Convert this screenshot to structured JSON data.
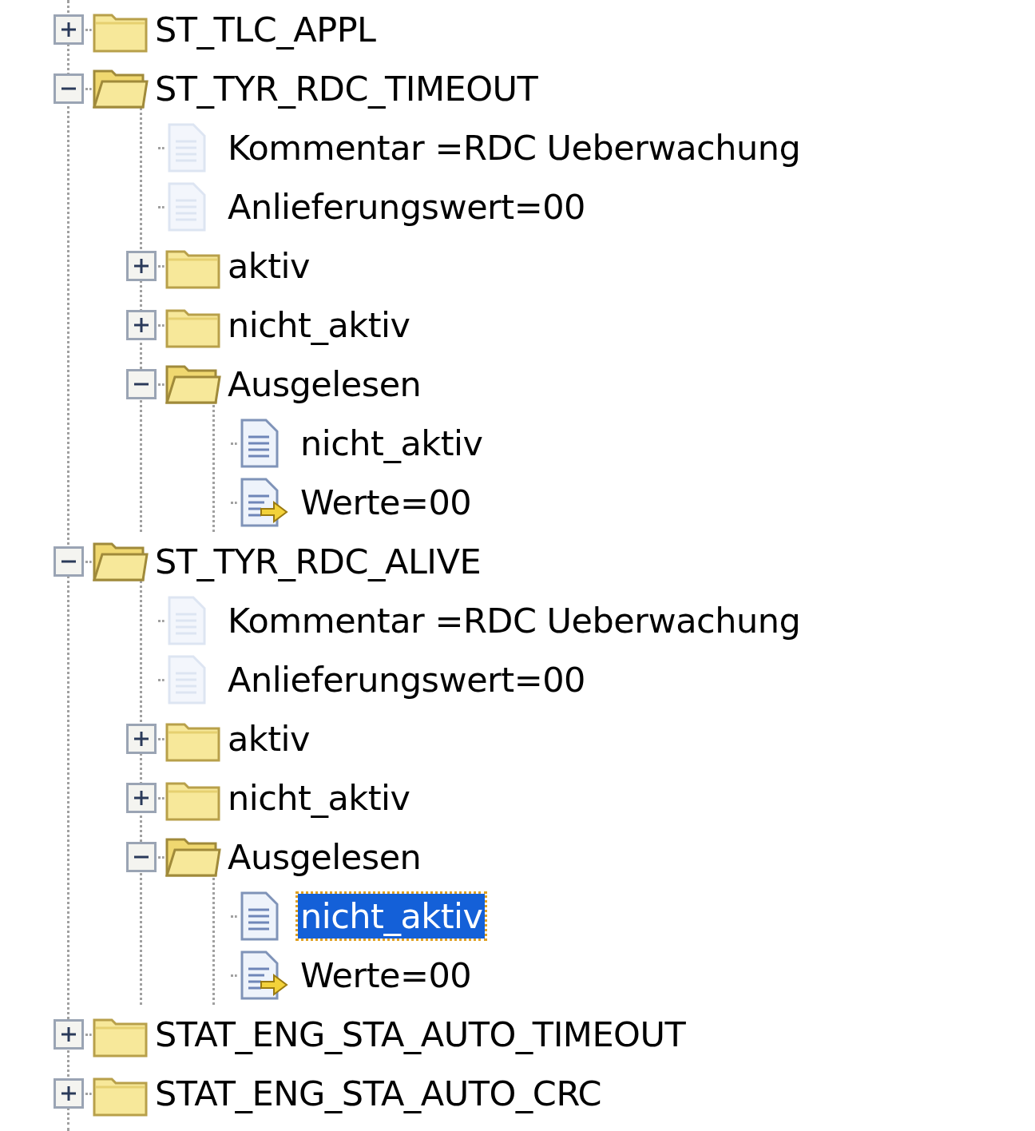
{
  "tree": [
    {
      "label": "ST_TLC_APPL",
      "kind": "folder",
      "expanded": false,
      "selected": false
    },
    {
      "label": "ST_TYR_RDC_TIMEOUT",
      "kind": "folder",
      "expanded": true,
      "selected": false,
      "children": [
        {
          "label": "Kommentar =RDC Ueberwachung",
          "kind": "faded-doc",
          "selected": false
        },
        {
          "label": "Anlieferungswert=00",
          "kind": "faded-doc",
          "selected": false
        },
        {
          "label": "aktiv",
          "kind": "folder",
          "expanded": false,
          "selected": false
        },
        {
          "label": "nicht_aktiv",
          "kind": "folder",
          "expanded": false,
          "selected": false
        },
        {
          "label": "Ausgelesen",
          "kind": "folder",
          "expanded": true,
          "selected": false,
          "children": [
            {
              "label": "nicht_aktiv",
              "kind": "doc",
              "selected": false
            },
            {
              "label": "Werte=00",
              "kind": "arrow-doc",
              "selected": false
            }
          ]
        }
      ]
    },
    {
      "label": "ST_TYR_RDC_ALIVE",
      "kind": "folder",
      "expanded": true,
      "selected": false,
      "children": [
        {
          "label": "Kommentar =RDC Ueberwachung",
          "kind": "faded-doc",
          "selected": false
        },
        {
          "label": "Anlieferungswert=00",
          "kind": "faded-doc",
          "selected": false
        },
        {
          "label": "aktiv",
          "kind": "folder",
          "expanded": false,
          "selected": false
        },
        {
          "label": "nicht_aktiv",
          "kind": "folder",
          "expanded": false,
          "selected": false
        },
        {
          "label": "Ausgelesen",
          "kind": "folder",
          "expanded": true,
          "selected": false,
          "children": [
            {
              "label": "nicht_aktiv",
              "kind": "doc",
              "selected": true
            },
            {
              "label": "Werte=00",
              "kind": "arrow-doc",
              "selected": false
            }
          ]
        }
      ]
    },
    {
      "label": "STAT_ENG_STA_AUTO_TIMEOUT",
      "kind": "folder",
      "expanded": false,
      "selected": false
    },
    {
      "label": "STAT_ENG_STA_AUTO_CRC",
      "kind": "folder",
      "expanded": false,
      "selected": false
    }
  ]
}
